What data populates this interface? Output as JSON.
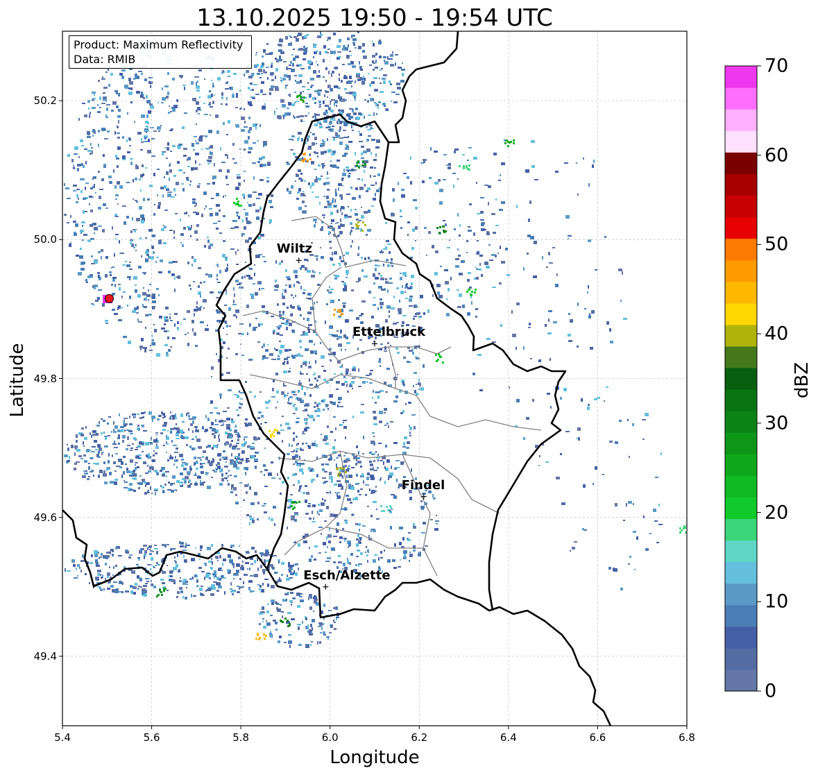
{
  "title": "13.10.2025 19:50 - 19:54 UTC",
  "info": {
    "product_line": "Product: Maximum Reflectivity",
    "data_line": "Data: RMIB"
  },
  "axes": {
    "xlabel": "Longitude",
    "ylabel": "Latitude",
    "xlim": [
      5.4,
      6.8
    ],
    "ylim": [
      49.3,
      50.3
    ],
    "xticks": [
      "5.4",
      "5.6",
      "5.8",
      "6.0",
      "6.2",
      "6.4",
      "6.6",
      "6.8"
    ],
    "yticks": [
      "49.4",
      "49.6",
      "49.8",
      "50.0",
      "50.2"
    ],
    "grid": true
  },
  "colorbar": {
    "label": "dBZ",
    "range": [
      0,
      70
    ],
    "ticks": [
      "0",
      "10",
      "20",
      "30",
      "40",
      "50",
      "60",
      "70"
    ],
    "colors": [
      "#6576a8",
      "#536da3",
      "#4560a7",
      "#4a7db4",
      "#5b9ac7",
      "#64bfdc",
      "#5fd6c6",
      "#3cd67a",
      "#12c92b",
      "#10ba22",
      "#0fa81c",
      "#0d9618",
      "#0b8415",
      "#097312",
      "#065e0e",
      "#44781a",
      "#b0b40a",
      "#ffd700",
      "#ffb800",
      "#ff9a00",
      "#ff7a00",
      "#e60000",
      "#c80000",
      "#a80000",
      "#7a0000",
      "#ffe0ff",
      "#ffb0ff",
      "#ff6eff",
      "#ee37ee"
    ]
  },
  "cities": [
    {
      "name": "Wiltz",
      "lon": 5.93,
      "lat": 49.97
    },
    {
      "name": "Ettelbruck",
      "lon": 6.1,
      "lat": 49.85
    },
    {
      "name": "Findel",
      "lon": 6.21,
      "lat": 49.63
    },
    {
      "name": "Esch/Alzette",
      "lon": 5.99,
      "lat": 49.5
    }
  ],
  "radar_site": {
    "lon": 5.505,
    "lat": 49.915
  },
  "colors": {
    "border": "#000000",
    "cantons": "#808080",
    "grid": "#c8c8c8",
    "radar_marker": "#e8141e"
  }
}
